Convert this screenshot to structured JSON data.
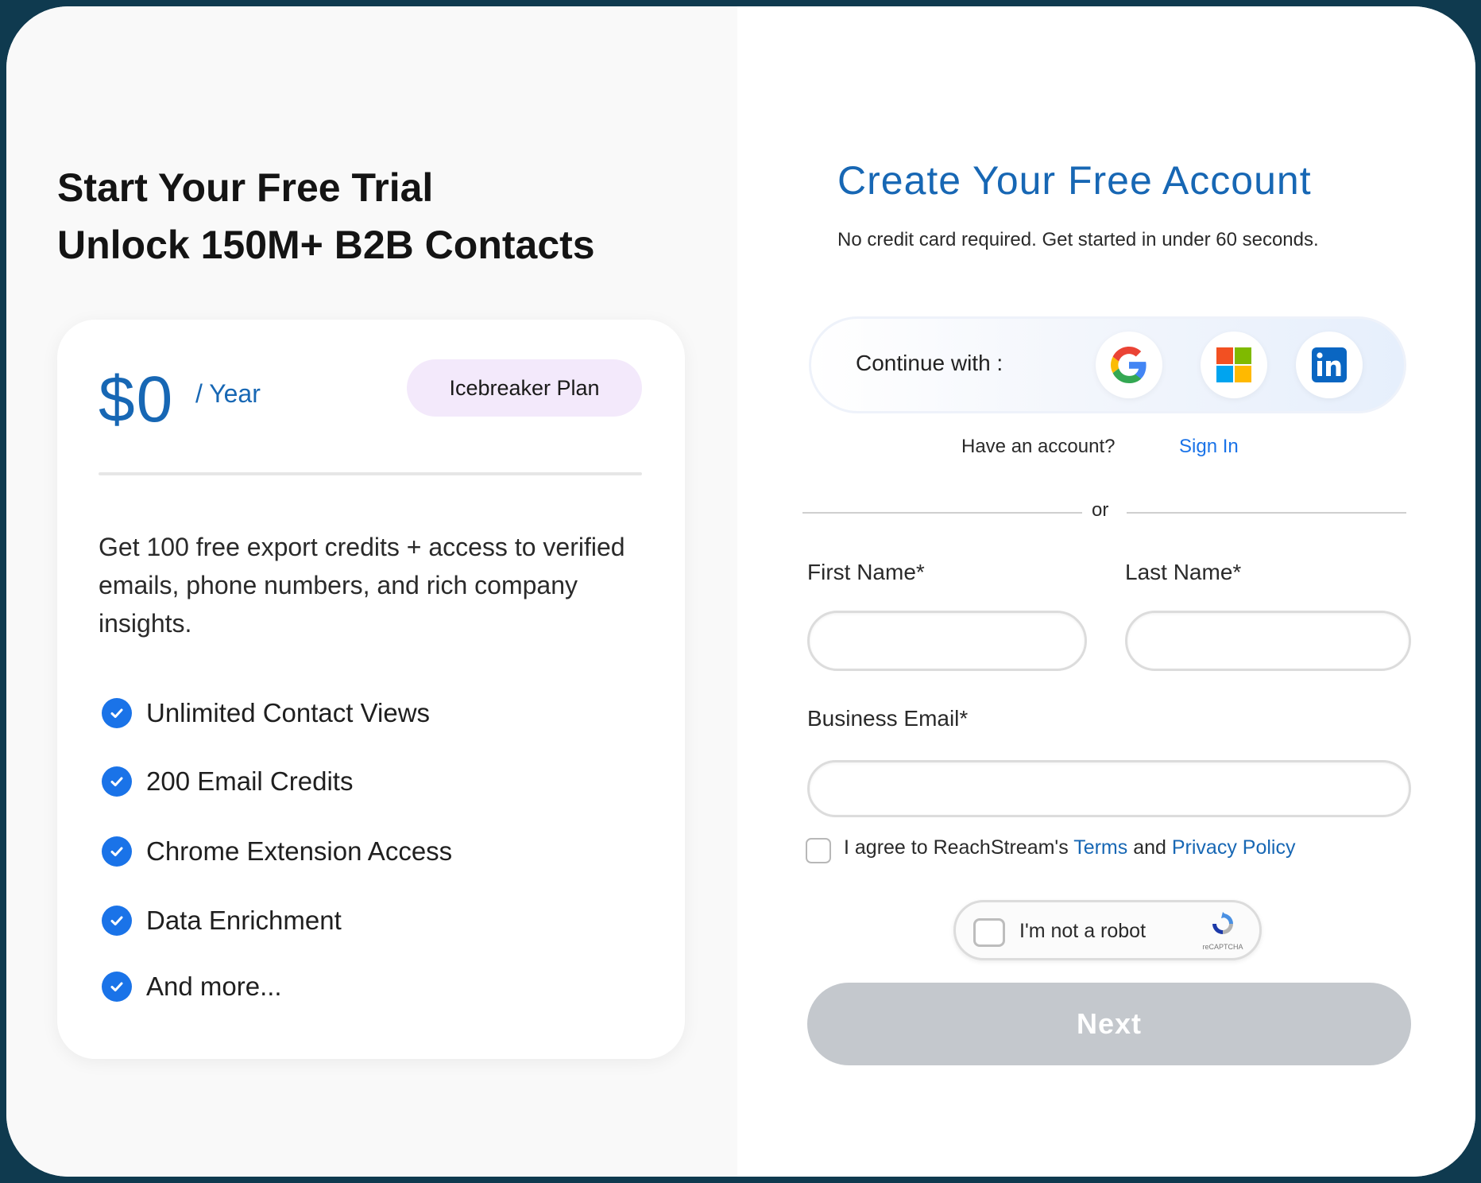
{
  "left": {
    "headline_line1": "Start Your Free Trial",
    "headline_line2": "Unlock 150M+ B2B Contacts",
    "card": {
      "price": "$0",
      "period": "/ Year",
      "plan_badge": "Icebreaker Plan",
      "description": "Get 100 free export credits + access to verified emails, phone numbers, and rich company insights.",
      "features": [
        "Unlimited Contact Views",
        "200 Email Credits",
        "Chrome Extension Access",
        "Data Enrichment",
        "And more..."
      ]
    }
  },
  "right": {
    "title": "Create Your Free Account",
    "subtitle": "No credit card required. Get started in under 60 seconds.",
    "social": {
      "label": "Continue with :",
      "providers": [
        "google-icon",
        "microsoft-icon",
        "linkedin-icon"
      ]
    },
    "have_account": "Have an account?",
    "sign_in": "Sign In",
    "divider_text": "or",
    "fields": {
      "first_name_label": "First Name*",
      "last_name_label": "Last Name*",
      "email_label": "Business Email*",
      "first_name_value": "",
      "last_name_value": "",
      "email_value": ""
    },
    "agree": {
      "prefix": "I agree to ReachStream's ",
      "terms": "Terms",
      "and": " and ",
      "privacy": "Privacy Policy"
    },
    "captcha": {
      "label": "I'm not a robot",
      "brand": "reCAPTCHA"
    },
    "next_button": "Next"
  },
  "colors": {
    "accent_blue": "#1767b4",
    "link_blue": "#1a73e8",
    "badge_bg": "#f3e9fb",
    "button_disabled": "#c4c8cd",
    "frame": "#0f3a4f"
  }
}
